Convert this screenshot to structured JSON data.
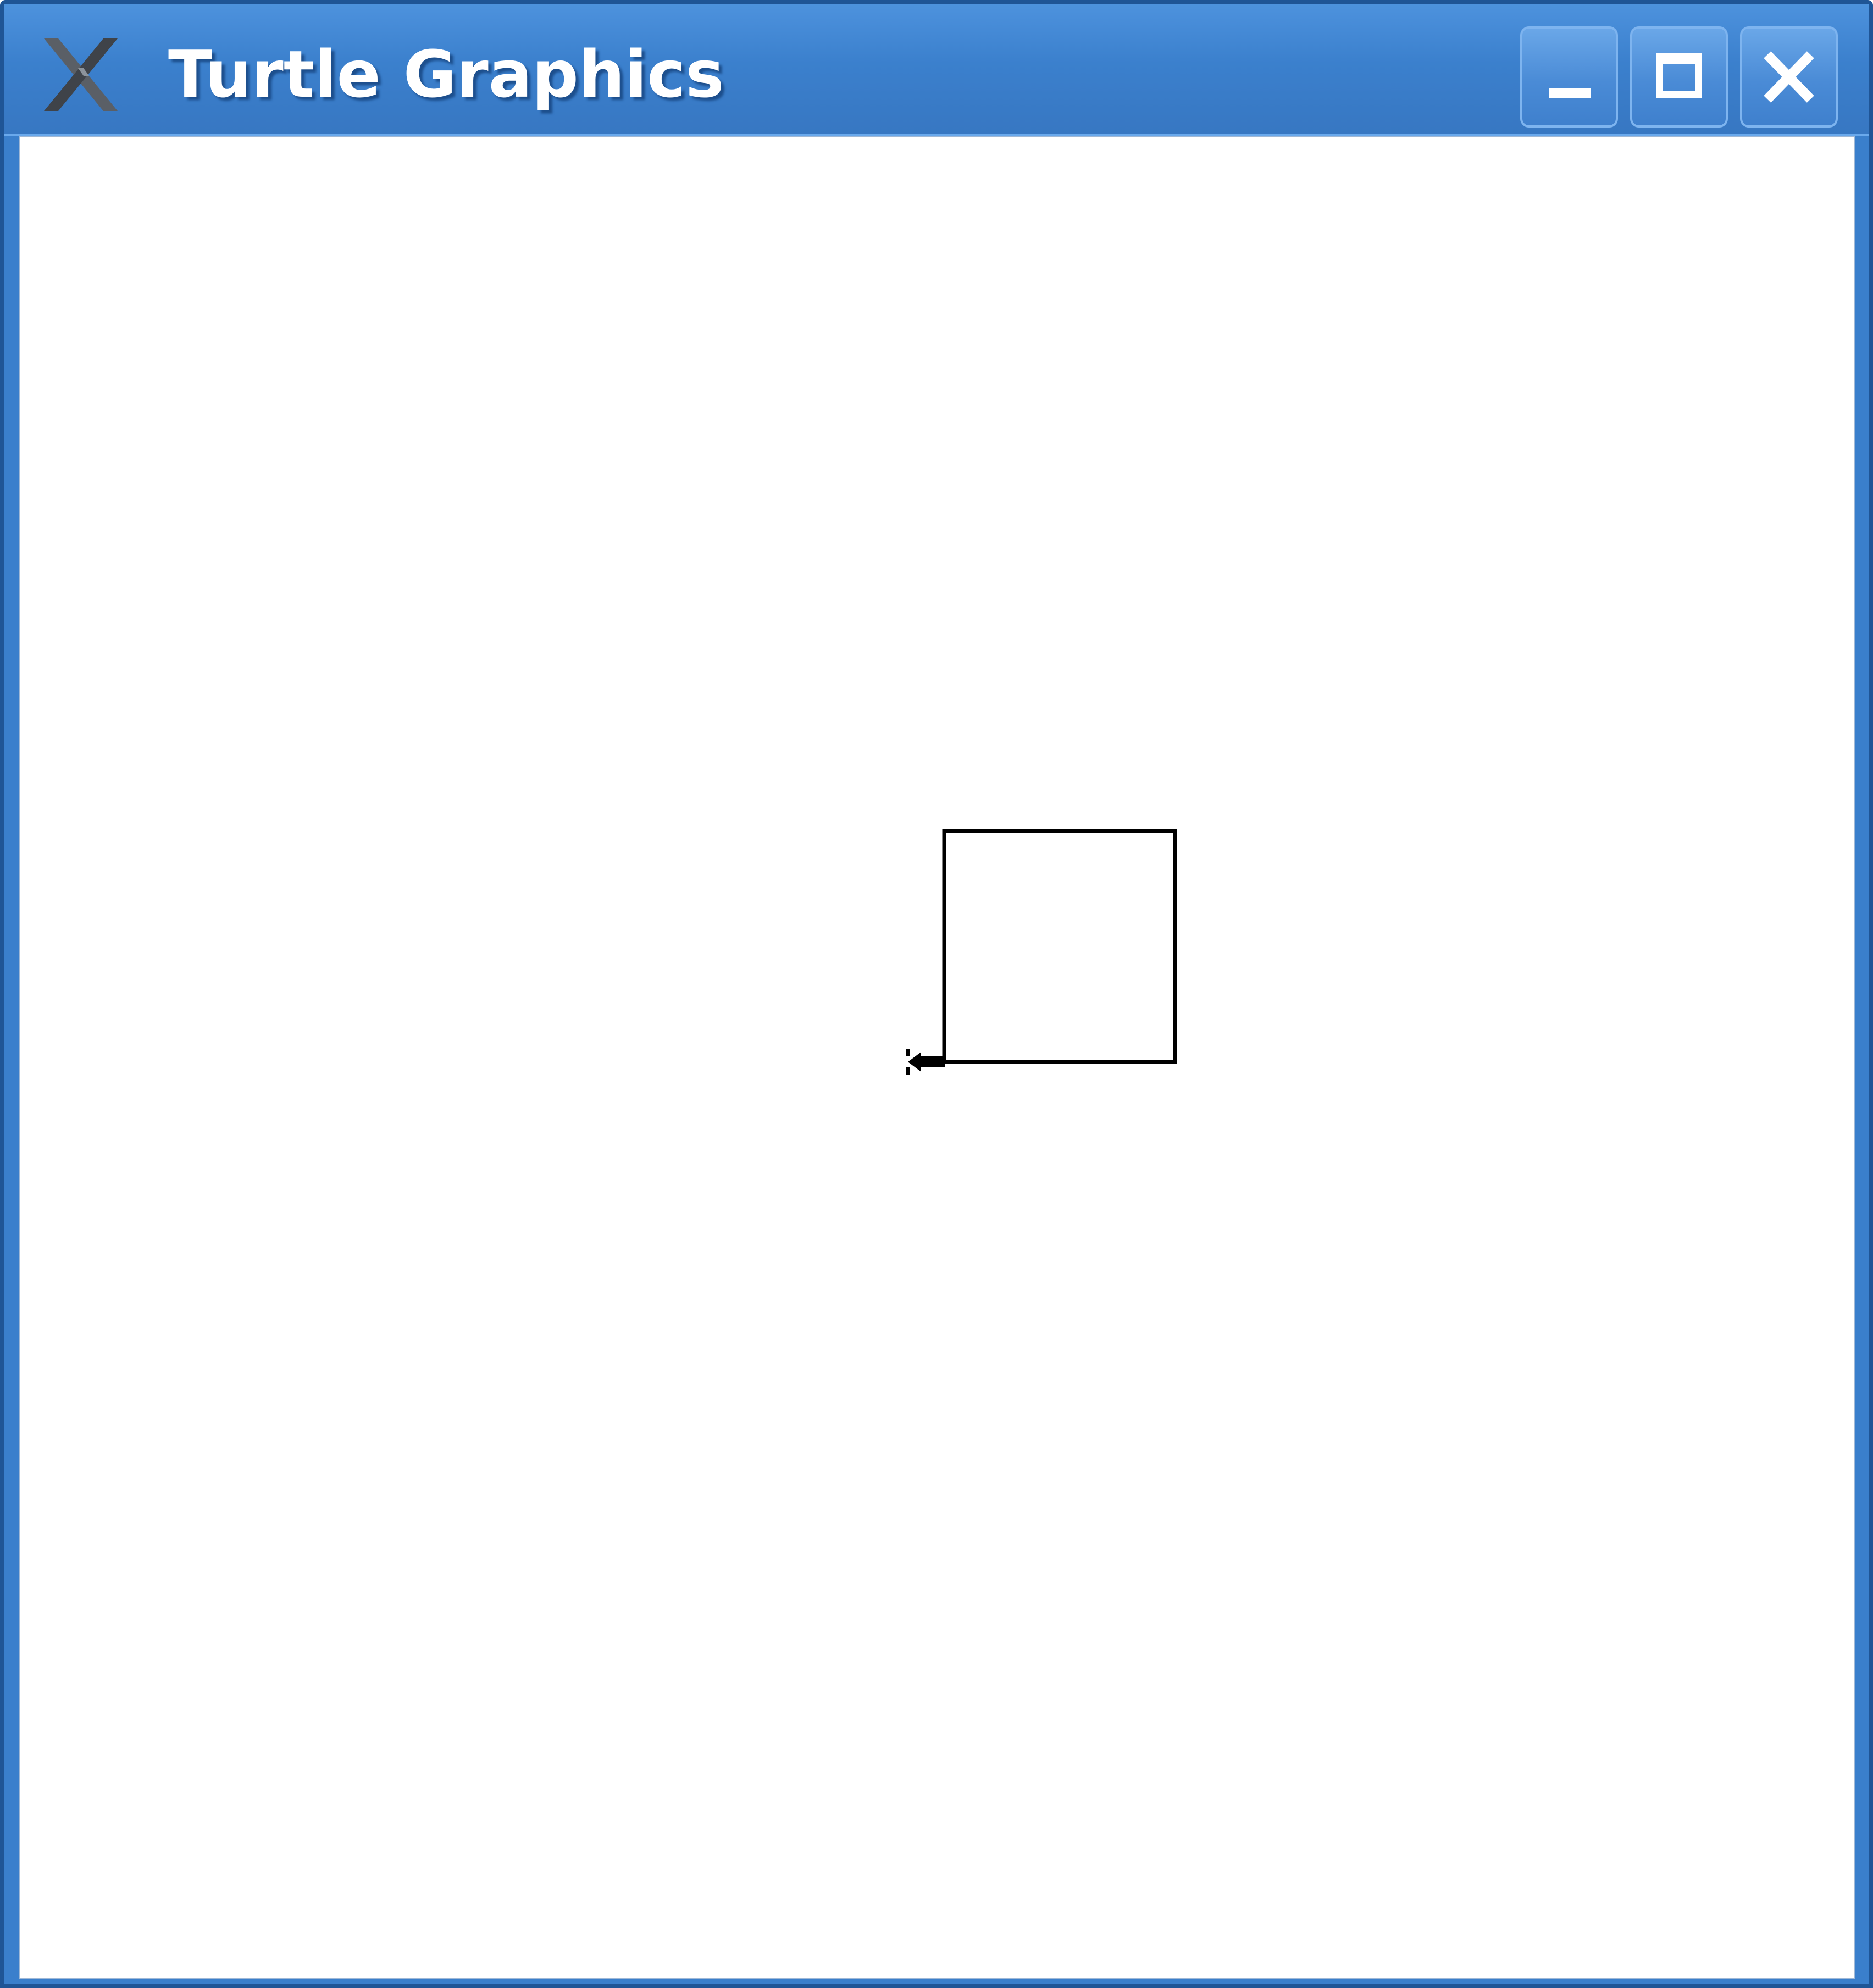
{
  "window": {
    "title": "Turtle Graphics",
    "app_icon": "x-logo-icon",
    "controls": {
      "minimize": "minimize-icon",
      "maximize": "maximize-icon",
      "close": "close-icon"
    }
  },
  "colors": {
    "titlebar": "#3a7fcc",
    "canvas": "#ffffff",
    "pen": "#000000"
  },
  "turtle": {
    "shape": "arrow",
    "heading": "west",
    "pen_color": "#000000"
  }
}
